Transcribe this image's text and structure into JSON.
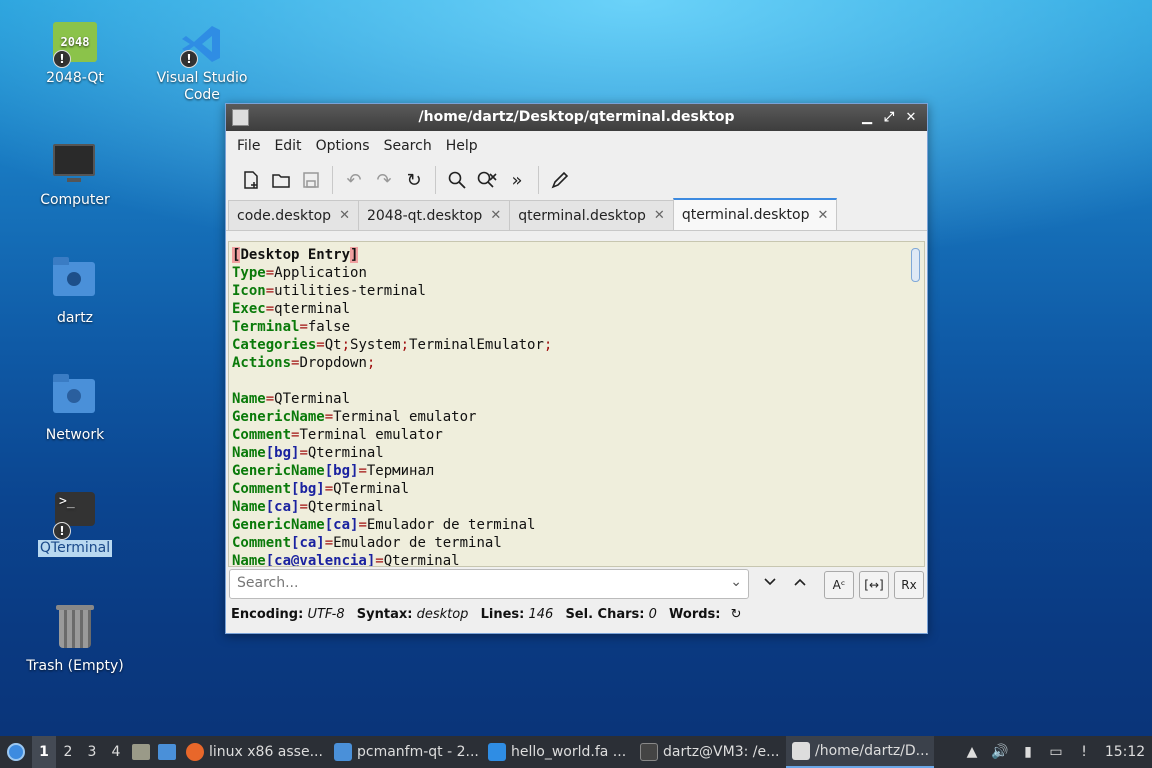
{
  "desktop": {
    "icons": [
      {
        "label": "2048-Qt",
        "glyph": "2048"
      },
      {
        "label": "Visual Studio Code"
      },
      {
        "label": "Computer"
      },
      {
        "label": "dartz"
      },
      {
        "label": "Network"
      },
      {
        "label": "QTerminal"
      },
      {
        "label": "Trash (Empty)"
      }
    ],
    "badge_symbol": "!"
  },
  "window": {
    "title": "/home/dartz/Desktop/qterminal.desktop",
    "controls": {
      "minimize": "▁",
      "maximize": "⤢",
      "close": "✕"
    },
    "menu": [
      "File",
      "Edit",
      "Options",
      "Search",
      "Help"
    ],
    "toolbar_icons": [
      "new-file-icon",
      "open-folder-icon",
      "save-icon",
      "undo-icon",
      "redo-icon",
      "reload-icon",
      "find-icon",
      "find-replace-icon",
      "find-next-icon",
      "edit-pen-icon"
    ],
    "tabs": [
      {
        "label": "code.desktop"
      },
      {
        "label": "2048-qt.desktop"
      },
      {
        "label": "qterminal.desktop"
      },
      {
        "label": "qterminal.desktop",
        "active": true
      }
    ],
    "tab_close": "✕",
    "editor": {
      "section": "Desktop Entry",
      "lines": [
        {
          "key": "Type",
          "val": "Application"
        },
        {
          "key": "Icon",
          "val": "utilities-terminal"
        },
        {
          "key": "Exec",
          "val": "qterminal"
        },
        {
          "key": "Terminal",
          "val": "false"
        },
        {
          "key": "Categories",
          "val": "Qt;System;TerminalEmulator;"
        },
        {
          "key": "Actions",
          "val": "Dropdown;"
        },
        {
          "key": "",
          "val": ""
        },
        {
          "key": "Name",
          "val": "QTerminal"
        },
        {
          "key": "GenericName",
          "val": "Terminal emulator"
        },
        {
          "key": "Comment",
          "val": "Terminal emulator"
        },
        {
          "key": "Name",
          "loc": "[bg]",
          "val": "Qterminal"
        },
        {
          "key": "GenericName",
          "loc": "[bg]",
          "val": "Терминал"
        },
        {
          "key": "Comment",
          "loc": "[bg]",
          "val": "QTerminal"
        },
        {
          "key": "Name",
          "loc": "[ca]",
          "val": "Qterminal"
        },
        {
          "key": "GenericName",
          "loc": "[ca]",
          "val": "Emulador de terminal"
        },
        {
          "key": "Comment",
          "loc": "[ca]",
          "val": "Emulador de terminal"
        },
        {
          "key": "Name",
          "loc": "[ca@valencia]",
          "val": "Qterminal"
        }
      ]
    },
    "search": {
      "placeholder": "Search...",
      "btn_case": "Aᶜ",
      "btn_whole": "[↔]",
      "btn_regex": "Rx"
    },
    "status": {
      "encoding_label": "Encoding:",
      "encoding": "UTF-8",
      "syntax_label": "Syntax:",
      "syntax": "desktop",
      "lines_label": "Lines:",
      "lines": "146",
      "selchars_label": "Sel. Chars:",
      "selchars": "0",
      "words_label": "Words:",
      "refresh": "↻"
    }
  },
  "taskbar": {
    "workspaces": [
      "1",
      "2",
      "3",
      "4"
    ],
    "tasks": [
      {
        "label": "linux x86 asse...",
        "color": "#e8672a"
      },
      {
        "label": "pcmanfm-qt - 2...",
        "color": "#4a90d9"
      },
      {
        "label": "hello_world.fa ...",
        "color": "#2f8de4"
      },
      {
        "label": "dartz@VM3: /e...",
        "color": "#444"
      },
      {
        "label": "/home/dartz/D...",
        "color": "#ddd",
        "active": true
      }
    ],
    "clock": "15:12"
  }
}
